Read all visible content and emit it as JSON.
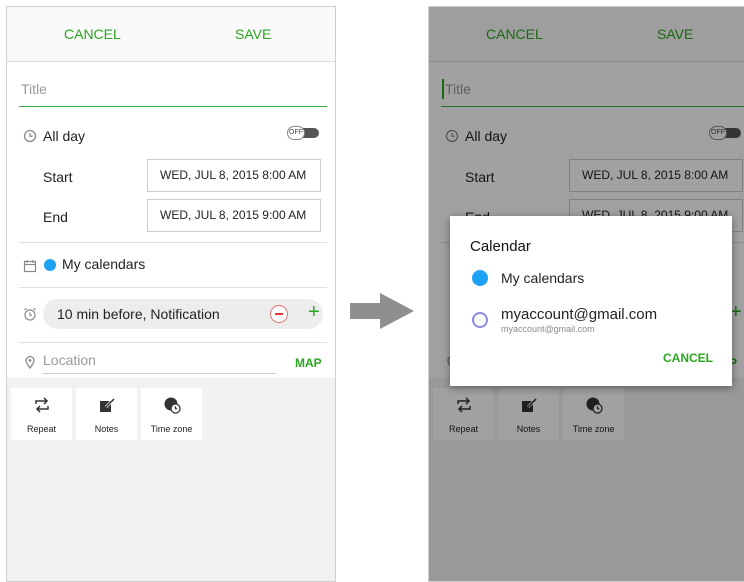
{
  "left_screen": {
    "topbar": {
      "cancel": "CANCEL",
      "save": "SAVE"
    },
    "title_placeholder": "Title",
    "all_day": {
      "label": "All day",
      "toggle": "OFF"
    },
    "start": {
      "label": "Start",
      "value": "WED, JUL 8, 2015   8:00 AM"
    },
    "end": {
      "label": "End",
      "value": "WED, JUL 8, 2015   9:00 AM"
    },
    "calendar": {
      "label": "My calendars"
    },
    "reminder": {
      "value": "10 min before, Notification"
    },
    "location": {
      "placeholder": "Location",
      "map": "MAP"
    },
    "tiles": [
      {
        "label": "Repeat",
        "icon": "repeat-icon"
      },
      {
        "label": "Notes",
        "icon": "notes-icon"
      },
      {
        "label": "Time zone",
        "icon": "timezone-icon"
      }
    ]
  },
  "right_screen": {
    "topbar": {
      "cancel": "CANCEL",
      "save": "SAVE"
    },
    "title_placeholder": "Title",
    "all_day": {
      "label": "All day",
      "toggle": "OFF"
    },
    "start": {
      "label": "Start",
      "value": "WED, JUL 8, 2015   8:00 AM"
    },
    "end": {
      "label": "End",
      "value": "WED, JUL 8, 2015   9:00 AM"
    },
    "tiles": [
      {
        "label": "Repeat"
      },
      {
        "label": "Notes"
      },
      {
        "label": "Time zone"
      }
    ],
    "dialog": {
      "title": "Calendar",
      "option_selected": "My calendars",
      "option_other": "myaccount@gmail.com",
      "option_other_sub": "myaccount@gmail.com",
      "cancel": "CANCEL",
      "map_partial": "P",
      "plus_partial": "+"
    }
  },
  "colors": {
    "accent": "#2aa520",
    "calendar_dot": "#1ea1f2",
    "remove": "#e53935"
  }
}
